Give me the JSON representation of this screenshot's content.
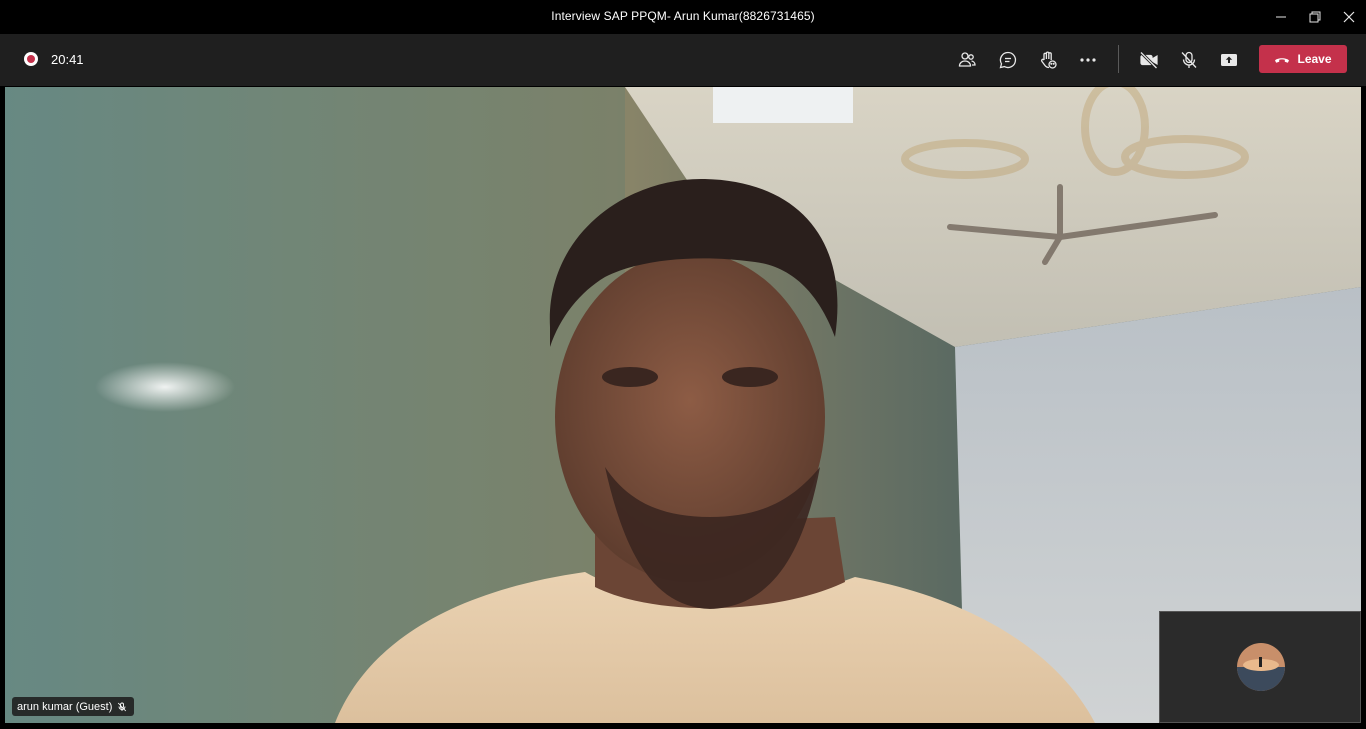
{
  "window": {
    "title": "Interview SAP PPQM- Arun Kumar(8826731465)",
    "controls": [
      "minimize-icon",
      "restore-icon",
      "close-icon"
    ]
  },
  "toolbar": {
    "recording_indicator": "record-icon",
    "elapsed_time": "20:41",
    "actions": [
      "participants-icon",
      "chat-icon",
      "reactions-icon",
      "more-options-icon",
      "camera-off-icon",
      "mic-off-icon",
      "share-screen-icon"
    ],
    "leave_label": "Leave",
    "leave_color": "#c4314b"
  },
  "stage": {
    "participant_name": "arun kumar (Guest)",
    "participant_muted_icon": "mic-off-icon"
  },
  "self_view": {
    "avatar": "avatar-photo"
  }
}
